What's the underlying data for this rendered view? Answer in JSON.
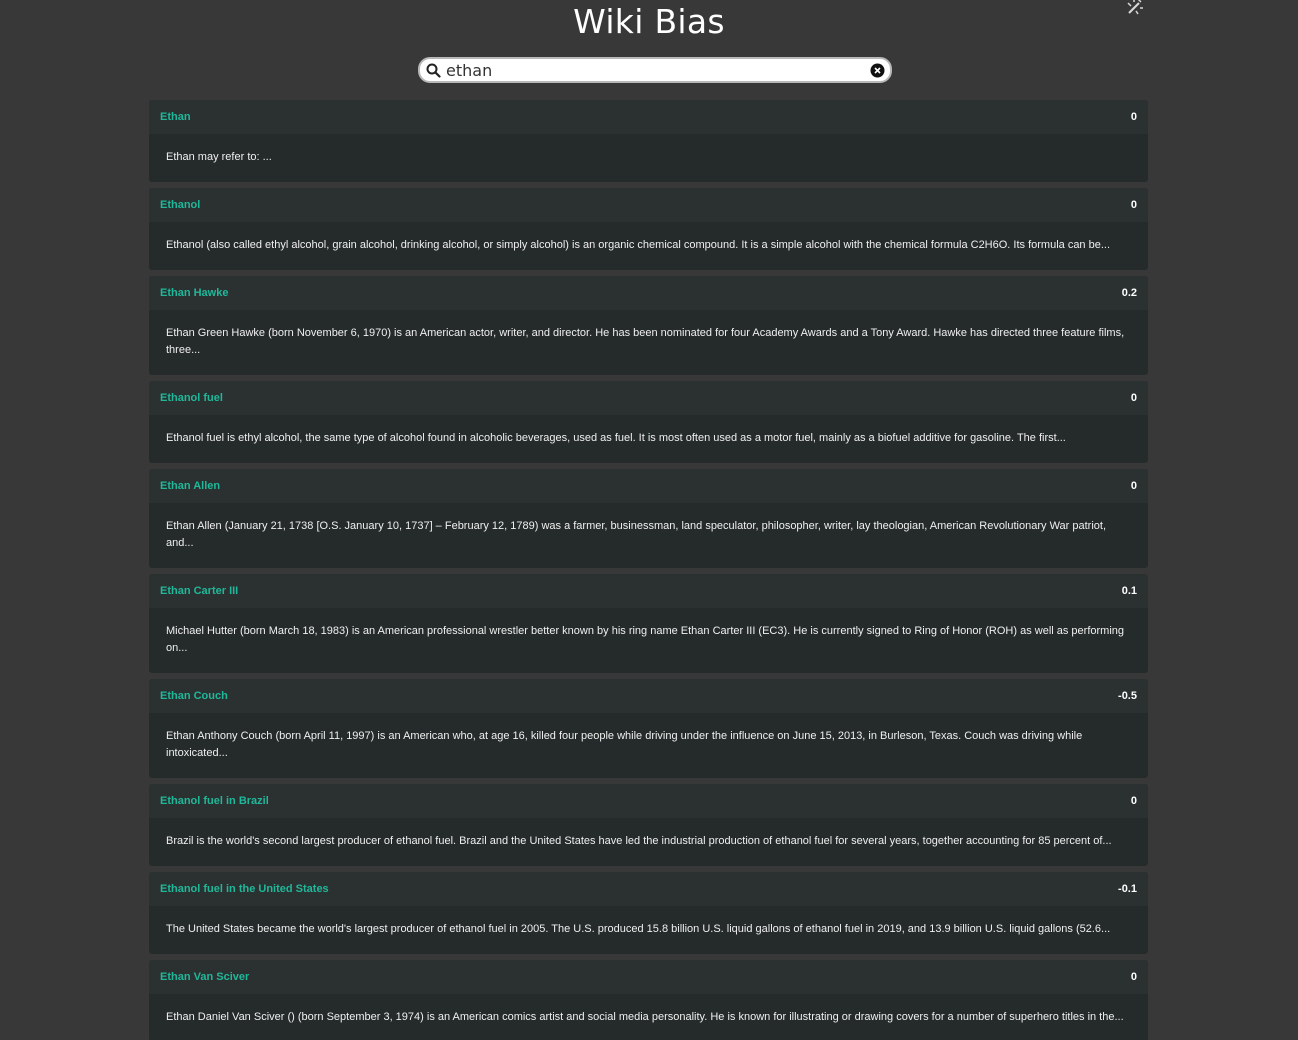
{
  "app": {
    "title": "Wiki Bias",
    "theme_toggle_icon": "magic-wand-icon"
  },
  "search": {
    "value": "ethan",
    "placeholder": "",
    "search_icon": "search-icon",
    "clear_icon": "clear-icon"
  },
  "results": [
    {
      "title": "Ethan",
      "score": "0",
      "summary": "Ethan may refer to: ..."
    },
    {
      "title": "Ethanol",
      "score": "0",
      "summary": "Ethanol (also called ethyl alcohol, grain alcohol, drinking alcohol, or simply alcohol) is an organic chemical compound. It is a simple alcohol with the chemical formula C2H6O. Its formula can be..."
    },
    {
      "title": "Ethan Hawke",
      "score": "0.2",
      "summary": "Ethan Green Hawke (born November 6, 1970) is an American actor, writer, and director. He has been nominated for four Academy Awards and a Tony Award. Hawke has directed three feature films, three..."
    },
    {
      "title": "Ethanol fuel",
      "score": "0",
      "summary": "Ethanol fuel is ethyl alcohol, the same type of alcohol found in alcoholic beverages, used as fuel. It is most often used as a motor fuel, mainly as a biofuel additive for gasoline. The first..."
    },
    {
      "title": "Ethan Allen",
      "score": "0",
      "summary": "Ethan Allen (January 21, 1738 [O.S. January 10, 1737] – February 12, 1789) was a farmer, businessman, land speculator, philosopher, writer, lay theologian, American Revolutionary War patriot, and..."
    },
    {
      "title": "Ethan Carter III",
      "score": "0.1",
      "summary": "Michael Hutter (born March 18, 1983) is an American professional wrestler better known by his ring name Ethan Carter III (EC3). He is currently signed to Ring of Honor (ROH) as well as performing on..."
    },
    {
      "title": "Ethan Couch",
      "score": "-0.5",
      "summary": "Ethan Anthony Couch (born April 11, 1997) is an American who, at age 16, killed four people while driving under the influence on June 15, 2013, in Burleson, Texas. Couch was driving while intoxicated..."
    },
    {
      "title": "Ethanol fuel in Brazil",
      "score": "0",
      "summary": "Brazil is the world's second largest producer of ethanol fuel. Brazil and the United States have led the industrial production of ethanol fuel for several years, together accounting for 85 percent of..."
    },
    {
      "title": "Ethanol fuel in the United States",
      "score": "-0.1",
      "summary": "The United States became the world's largest producer of ethanol fuel in 2005. The U.S. produced 15.8 billion U.S. liquid gallons of ethanol fuel in 2019, and 13.9 billion U.S. liquid gallons (52.6..."
    },
    {
      "title": "Ethan Van Sciver",
      "score": "0",
      "summary": "Ethan Daniel Van Sciver () (born September 3, 1974) is an American comics artist and social media personality. He is known for illustrating or drawing covers for a number of superhero titles in the..."
    }
  ],
  "colors": {
    "background": "#383838",
    "card": "#252a2a",
    "card_header": "#2b3030",
    "link": "#1fb89a"
  }
}
